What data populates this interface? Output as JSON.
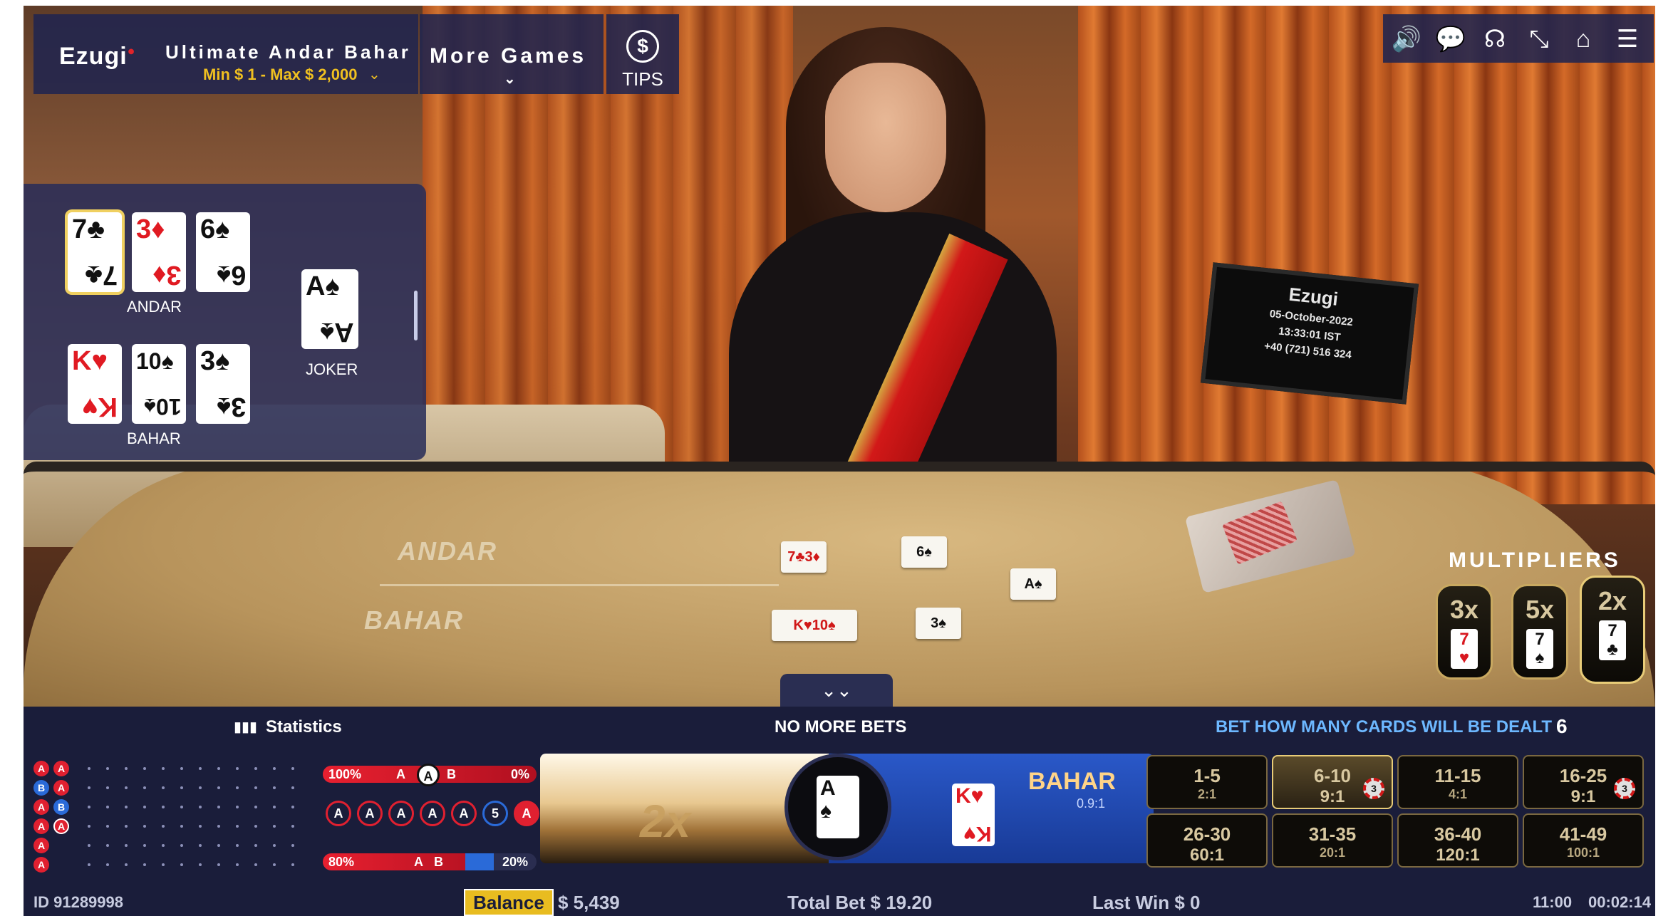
{
  "header": {
    "brand": "Ezugi",
    "game_title": "Ultimate Andar Bahar",
    "limits": "Min $ 1 - Max $ 2,000",
    "more_games": "More Games",
    "tips": "TIPS",
    "tools": [
      {
        "icon": "speaker-icon",
        "glyph": "🔊"
      },
      {
        "icon": "chat-icon",
        "glyph": "💬"
      },
      {
        "icon": "headset-icon",
        "glyph": "☊"
      },
      {
        "icon": "minimize-icon",
        "glyph": "⤡"
      },
      {
        "icon": "home-icon",
        "glyph": "⌂"
      },
      {
        "icon": "menu-icon",
        "glyph": "☰"
      }
    ]
  },
  "video": {
    "monitor_brand": "Ezugi",
    "monitor_date": "05-October-2022",
    "monitor_time": "13:33:01 IST",
    "monitor_phone": "+40 (721) 516 324",
    "table_andar": "ANDAR",
    "table_bahar": "BAHAR"
  },
  "card_panel": {
    "andar_label": "ANDAR",
    "bahar_label": "BAHAR",
    "joker_label": "JOKER",
    "andar_cards": [
      {
        "rank": "7",
        "suit": "♣",
        "color": "black"
      },
      {
        "rank": "3",
        "suit": "♦",
        "color": "red"
      },
      {
        "rank": "6",
        "suit": "♠",
        "color": "black"
      }
    ],
    "bahar_cards": [
      {
        "rank": "K",
        "suit": "♥",
        "color": "red"
      },
      {
        "rank": "10",
        "suit": "♠",
        "color": "black"
      },
      {
        "rank": "3",
        "suit": "♠",
        "color": "black"
      }
    ],
    "joker": {
      "rank": "A",
      "suit": "♠",
      "color": "black"
    }
  },
  "multipliers": {
    "title": "MULTIPLIERS",
    "items": [
      {
        "mult": "3x",
        "rank": "7",
        "suit": "♥",
        "color": "red"
      },
      {
        "mult": "5x",
        "rank": "7",
        "suit": "♠",
        "color": "black"
      },
      {
        "mult": "2x",
        "rank": "7",
        "suit": "♣",
        "color": "black"
      }
    ]
  },
  "panel": {
    "stats_label": "Statistics",
    "status": "NO MORE BETS",
    "side_prompt": "BET HOW MANY CARDS WILL BE DEALT",
    "side_count": "6",
    "beads": [
      [
        "A",
        "A"
      ],
      [
        "B",
        "A"
      ],
      [
        "A",
        "B"
      ],
      [
        "A",
        "A"
      ],
      [
        "A"
      ],
      [
        "A"
      ]
    ],
    "bar_top": {
      "left_pct": "100%",
      "left_letter": "A",
      "mid_letter": "A",
      "right_letter": "B",
      "right_pct": "0%",
      "fill_a": 1.0
    },
    "bar_bottom": {
      "left_pct": "80%",
      "left_letter": "A",
      "right_letter": "B",
      "right_pct": "20%",
      "fill_a": 0.8
    },
    "roll": [
      "A",
      "A",
      "A",
      "A",
      "A",
      "5",
      "A"
    ],
    "andar_mult": "2x",
    "bahar_label": "BAHAR",
    "bahar_odds": "0.9:1",
    "joker_card": {
      "rank": "A",
      "suit": "♠"
    },
    "bahar_card": {
      "rank": "K",
      "suit": "♥"
    },
    "side_bets": [
      {
        "range": "1-5",
        "odds": "2:1"
      },
      {
        "range": "6-10",
        "odds": "9:1",
        "chip": "3"
      },
      {
        "range": "11-15",
        "odds": "4:1"
      },
      {
        "range": "16-25",
        "odds": "9:1",
        "chip": "3"
      },
      {
        "range": "26-30",
        "odds": "60:1"
      },
      {
        "range": "31-35",
        "odds": "20:1"
      },
      {
        "range": "36-40",
        "odds": "120:1"
      },
      {
        "range": "41-49",
        "odds": "100:1"
      }
    ]
  },
  "footer": {
    "id": "ID 91289998",
    "balance_label": "Balance",
    "balance_value": "$ 5,439",
    "total_bet": "Total Bet $ 19.20",
    "last_win": "Last Win $ 0",
    "time": "11:00",
    "timer": "00:02:14"
  }
}
